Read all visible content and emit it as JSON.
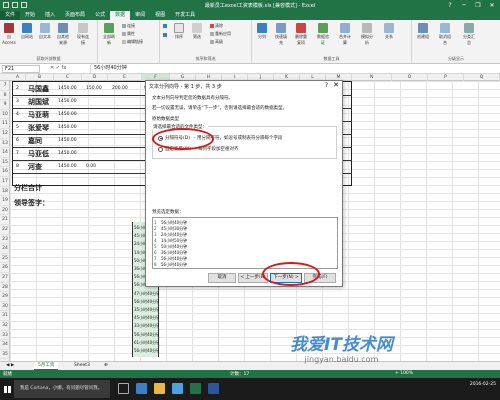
{
  "window": {
    "title": "最新员工excel工资表模板.xls [兼容模式] - Excel",
    "controls": [
      "?",
      "─",
      "❐",
      "✕"
    ],
    "user": "小明"
  },
  "tabs": [
    "文件",
    "开始",
    "插入",
    "页面布局",
    "公式",
    "数据",
    "审阅",
    "视图",
    "开发工具"
  ],
  "active_tab": "数据",
  "ribbon": {
    "groups": [
      {
        "label": "获取外部数据",
        "buttons": [
          "自 Access",
          "自网站",
          "自文本",
          "自其他来源",
          "现有连接"
        ]
      },
      {
        "label": "",
        "buttons": [
          "全部刷新"
        ],
        "small": [
          "连接",
          "属性",
          "编辑链接"
        ]
      },
      {
        "label": "排序和筛选",
        "buttons": [
          "排序",
          "筛选"
        ],
        "small": [
          "清除",
          "重新应用",
          "高级"
        ]
      },
      {
        "label": "数据工具",
        "buttons": [
          "分列",
          "快速填充",
          "删除重复项",
          "数据验证",
          "合并计算",
          "模拟分析",
          "关系"
        ]
      },
      {
        "label": "分级显示",
        "buttons": [
          "创建组",
          "取消组合",
          "分类汇总"
        ]
      }
    ]
  },
  "formula_bar": {
    "namebox": "F21",
    "content": "56小时40分钟"
  },
  "columns": [
    "A",
    "B",
    "C",
    "D",
    "E",
    "F",
    "G",
    "H",
    "I",
    "J",
    "K",
    "L",
    "M",
    "N",
    "O",
    "P",
    "Q"
  ],
  "rows": [
    "7",
    "8",
    "9",
    "10",
    "11",
    "12",
    "13",
    "14",
    "15",
    "16",
    "17",
    "18",
    "19",
    "20",
    "21",
    "22",
    "23",
    "24",
    "25",
    "26",
    "27",
    "28",
    "29",
    "30",
    "31",
    "32",
    "33",
    "34",
    "35"
  ],
  "table_rows": [
    {
      "no": "2",
      "name": "马国鑫",
      "c": "1450.00",
      "d": "150.00",
      "e": "200.00",
      "f": "900"
    },
    {
      "no": "3",
      "name": "胡国斌",
      "c": "1450.00",
      "d": "",
      "e": "",
      "f": ""
    },
    {
      "no": "4",
      "name": "马亚萌",
      "c": "1450.00",
      "d": "",
      "e": "",
      "f": ""
    },
    {
      "no": "5",
      "name": "张爱琴",
      "c": "1450.00",
      "d": "",
      "e": "",
      "f": ""
    },
    {
      "no": "6",
      "name": "嘉同",
      "c": "1450.00",
      "d": "",
      "e": "",
      "f": ""
    },
    {
      "no": "7",
      "name": "马亚低",
      "c": "1450.00",
      "d": "",
      "e": "",
      "f": ""
    },
    {
      "no": "8",
      "name": "河查",
      "c": "1450.00",
      "d": "0.00",
      "e": "",
      "f": ""
    }
  ],
  "subtotal_label": "分栏合计",
  "signature_label": "领导签字：",
  "colF_values": [
    "56小时40分钟",
    "45小时30分钟",
    "24小时40分钟",
    "14小时50分钟",
    "50小时40分钟",
    "36小时40分钟",
    "56小时40分钟",
    "56小时40分钟",
    "47小时40分钟",
    "56小时40分钟",
    "35小时40分钟",
    "45小时40分钟",
    "33小时40分钟",
    "56小时40分钟",
    "61小时40分钟",
    "56小时40分钟"
  ],
  "dialog": {
    "title": "文本分列向导 - 第 1 步，共 3 步",
    "help": "?",
    "close": "✕",
    "line1": "文本分列向导判定您的数据具有分隔符。",
    "line2": "若一切设置无误，请单击“下一步”，否则请选择最合适的数据类型。",
    "section": "原始数据类型",
    "subsection": "请选择最合适的文件类型：",
    "radio1": "分隔符号(D)",
    "radio1_desc": "- 用分隔字符，如逗号或制表符分隔每个字段",
    "radio2": "固定宽度(W)",
    "radio2_desc": "- 每列字段加空格对齐",
    "preview_label": "预览选定数据：",
    "preview_rows": [
      {
        "n": "1",
        "t": "56小时40分钟"
      },
      {
        "n": "2",
        "t": "45小时30分钟"
      },
      {
        "n": "3",
        "t": "24小时40分钟"
      },
      {
        "n": "4",
        "t": "14小时50分钟"
      },
      {
        "n": "5",
        "t": "50小时40分钟"
      },
      {
        "n": "6",
        "t": "36小时40分钟"
      },
      {
        "n": "7",
        "t": "56小时40分钟"
      },
      {
        "n": "8",
        "t": "56小时40分钟"
      }
    ],
    "btn_cancel": "取消",
    "btn_back": "< 上一步(B)",
    "btn_next": "下一步(N) >",
    "btn_finish": "完成(F)"
  },
  "sheet_tabs": [
    "5月工资",
    "Sheet3"
  ],
  "statusbar": {
    "left": "就绪",
    "mid": "计数：17",
    "right": "+ 100%"
  },
  "taskbar": {
    "search": "我是 Cortana，小娜。有问题尽管问我。",
    "time": "2016-02-25"
  },
  "watermark": {
    "main": "我爱IT技术网",
    "sub": "jingyan.baidu.com"
  },
  "colors": {
    "excel_green": "#217346",
    "annotation_red": "#d6191c",
    "selected_fill": "#dbeee0"
  }
}
